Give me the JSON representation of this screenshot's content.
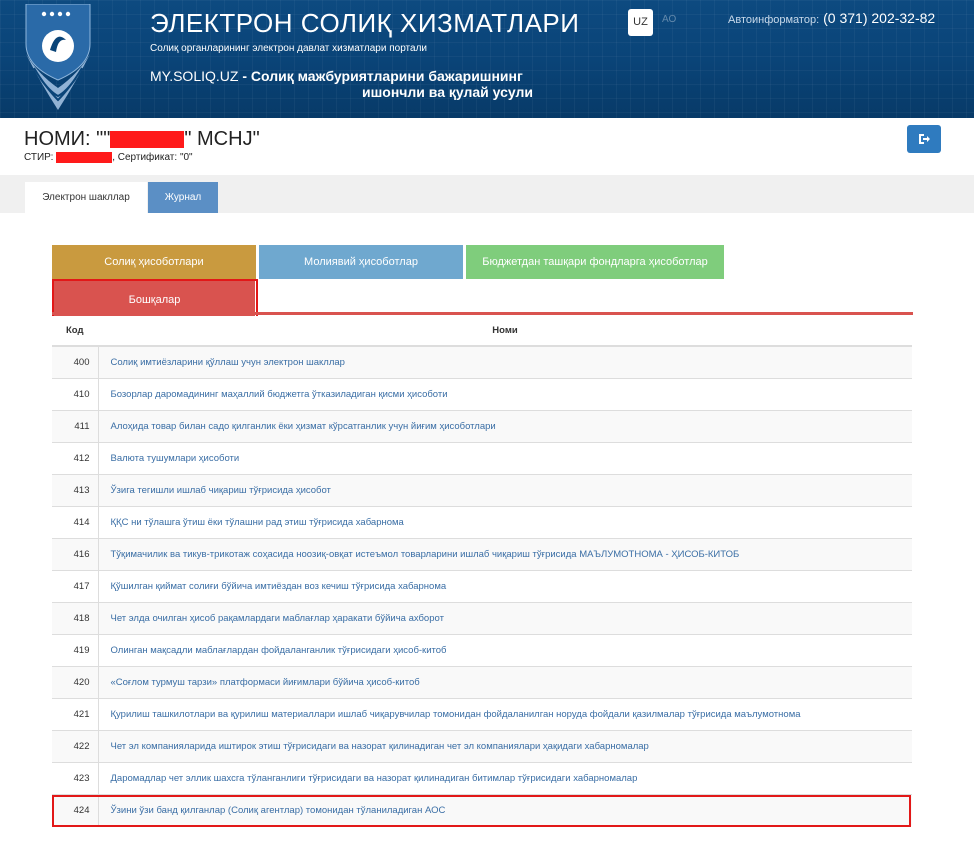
{
  "header": {
    "title": "ЭЛЕКТРОН СОЛИҚ ХИЗМАТЛАРИ",
    "subtitle": "Солиқ органларининг электрон давлат хизматлари портали",
    "site": "MY.SOLIQ.UZ",
    "slogan_line1": " - Солиқ мажбуриятларини бажаришнинг",
    "slogan_line2": "ишончли ва қулай усули",
    "lang": "UZ",
    "lang_alt": "АО",
    "autoinfo_label": "Автоинформатор:",
    "autoinfo_phone": "(0 371) 202-32-82"
  },
  "company": {
    "name_prefix": "НОМИ: \"\"",
    "name_suffix": "\" MCHJ\"",
    "stir_label": "СТИР:",
    "cert_text": ", Сертификат: \"0\"",
    "redaction_color": "#ff1a1a"
  },
  "tabs": {
    "active": "Электрон шакллар",
    "journal": "Журнал"
  },
  "categories": {
    "tax": "Солиқ ҳисоботлари",
    "financial": "Молиявий ҳисоботлар",
    "extrabudget": "Бюджетдан ташқари фондларга ҳисоботлар",
    "other": "Бошқалар"
  },
  "table": {
    "col_code": "Код",
    "col_name": "Номи",
    "rows": [
      {
        "code": "400",
        "name": "Солиқ имтиёзларини қўллаш учун электрон шакллар"
      },
      {
        "code": "410",
        "name": "Бозорлар даромадининг маҳаллий бюджетга ўтказиладиган қисми ҳисоботи"
      },
      {
        "code": "411",
        "name": "Алоҳида товар билан садо қилганлик ёки ҳизмат кўрсатганлик учун йиғим ҳисоботлари"
      },
      {
        "code": "412",
        "name": "Валюта тушумлари ҳисоботи"
      },
      {
        "code": "413",
        "name": "Ўзига тегишли ишлаб чиқариш тўғрисида ҳисобот"
      },
      {
        "code": "414",
        "name": "ҚҚС ни тўлашга ўтиш ёки тўлашни рад этиш тўғрисида хабарнома"
      },
      {
        "code": "416",
        "name": "Тўқимачилик ва тикув-трикотаж соҳасида ноозиқ-овқат истеъмол товарларини ишлаб чиқариш тўғрисида МАЪЛУМОТНОМА - ҲИСОБ-КИТОБ"
      },
      {
        "code": "417",
        "name": "Қўшилган қиймат солиғи бўйича имтиёздан воз кечиш тўғрисида хабарнома"
      },
      {
        "code": "418",
        "name": "Чет элда очилган ҳисоб рақамлардаги маблағлар ҳаракати бўйича ахборот"
      },
      {
        "code": "419",
        "name": "Олинган мақсадли маблағлардан фойдаланганлик тўғрисидаги ҳисоб-китоб"
      },
      {
        "code": "420",
        "name": "«Соғлом турмуш тарзи» платформаси йиғимлари бўйича ҳисоб-китоб"
      },
      {
        "code": "421",
        "name": "Қурилиш ташкилотлари ва қурилиш материаллари ишлаб чиқарувчилар томонидан фойдаланилган норуда фойдали қазилмалар тўғрисида маълумотнома"
      },
      {
        "code": "422",
        "name": "Чет эл компанияларида иштирок этиш тўғрисидаги ва назорат қилинадиган чет эл компаниялари ҳақидаги хабарномалар"
      },
      {
        "code": "423",
        "name": "Даромадлар чет эллик шахсга тўланганлиги тўғрисидаги ва назорат қилинадиган битимлар тўғрисидаги хабарномалар"
      },
      {
        "code": "424",
        "name": "Ўзини ўзи банд қилганлар (Солиқ агентлар) томонидан тўланиладиган АОС"
      }
    ]
  },
  "colors": {
    "header_bg": "#0a4478",
    "tab_tax": "#c99a3f",
    "tab_financial": "#6fa8cf",
    "tab_extrabudget": "#7fcd7c",
    "tab_other": "#d9534f",
    "highlight": "#e21818",
    "link": "#3a6ea5"
  }
}
